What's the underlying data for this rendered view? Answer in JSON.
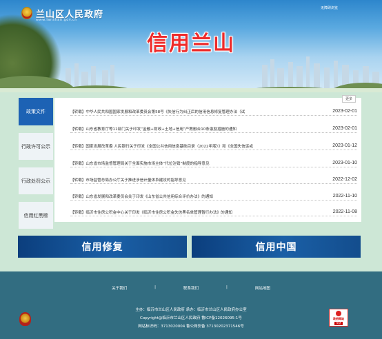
{
  "header": {
    "site_name": "兰山区人民政府",
    "site_subtitle": "www.lanshan.gov.cn",
    "barrier_free_link": "无障碍浏览",
    "page_title": "信用兰山"
  },
  "side_tabs": [
    {
      "label": "政策文件",
      "active": true
    },
    {
      "label": "行政许可公示",
      "active": false
    },
    {
      "label": "行政处罚公示",
      "active": false
    },
    {
      "label": "信用红黑榜",
      "active": false
    }
  ],
  "news": {
    "more_label": "更多",
    "items": [
      {
        "title": "【转载】中华人民共和国国家发展和改革委员会第58号《失信行为纠正后的信用信息修复管理办法（试",
        "date": "2023-02-01"
      },
      {
        "title": "【转载】山东省教育厅等11部门关于印发“金融+财政+土地+信用”产教融合10条激励措施的通知",
        "date": "2023-02-01"
      },
      {
        "title": "【转载】国家发展改革委 人民银行关于印发《全国公共信用信息基础目录（2022年版）》和《全国失信惩戒",
        "date": "2023-01-12"
      },
      {
        "title": "【转载】山东省市场监督管理局关于全面实施市场主体“代位注销”制度的指导意见",
        "date": "2023-01-10"
      },
      {
        "title": "【转载】市场监管总局办公厅关于推进涉信计量体系建设的指导意见",
        "date": "2022-12-02"
      },
      {
        "title": "【转载】山东省发展和改革委员会关于印发《山东省公共信用综合评价办法》的通知",
        "date": "2022-11-10"
      },
      {
        "title": "【转载】临沂市住房公积金中心关于印发《临沂市住房公积金失信黑名单管理暂行办法》的通知",
        "date": "2022-11-08"
      }
    ]
  },
  "banners": {
    "left": "信用修复",
    "right": "信用中国"
  },
  "footer": {
    "links": [
      "关于我们",
      "|",
      "联系我们",
      "|",
      "网站地图"
    ],
    "sponsor": "主办：临沂市兰山区人民政府 承办：临沂市兰山区人民政府办公室",
    "copyright": "Copyright@临沂市兰山区人民政府 鲁ICP备12026095-1号",
    "site_code": "网站标识码：3713020004  鲁公网安备 37130202371546号",
    "badge_line1": "政府网站",
    "badge_line2": "找错"
  },
  "colors": {
    "brand_blue": "#1d62b4",
    "title_red": "#ee2b2b",
    "footer_bg": "#326d81",
    "main_bg": "#cde7d6"
  }
}
